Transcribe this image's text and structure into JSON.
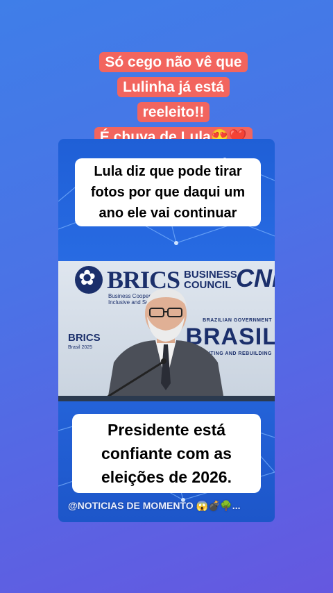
{
  "header_caption": {
    "lines": [
      "Só cego não vê que",
      "Lulinha já está",
      "reeleito!!",
      "É chuva de Lula😍❤️"
    ]
  },
  "video": {
    "bubble_top": "Lula diz que pode tirar fotos por que daqui um ano ele vai continuar",
    "bubble_bottom": "Presidente está confiante com as eleições de 2026.",
    "watermark": "@NOTICIAS DE MOMENTO 😱💣🌳...",
    "backdrop": {
      "brics_word": "BRICS",
      "business_line1": "BUSINESS",
      "business_line2": "COUNCIL",
      "tagline": "Business Cooperation for an Inclusive and Sustainable",
      "cni": "CNI",
      "gov": "BRAZILIAN GOVERNMENT",
      "brasil": "BRASIL",
      "rebuild": "UNITING AND REBUILDING",
      "brics_small": "BRICS",
      "brics_small_sub": "Brasil 2025"
    }
  },
  "colors": {
    "caption_bg": "#f2655e",
    "background_top": "#3f7ee8",
    "background_bottom": "#6558e0"
  }
}
